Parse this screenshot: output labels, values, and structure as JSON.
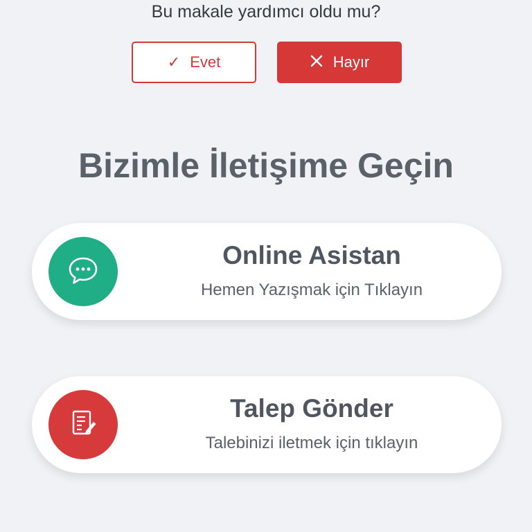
{
  "feedback": {
    "question": "Bu makale yardımcı oldu mu?",
    "yes_label": "Evet",
    "no_label": "Hayır",
    "yes_icon": "check-icon",
    "no_icon": "close-icon",
    "accent_color": "#d63838"
  },
  "contact": {
    "title": "Bizimle İletişime Geçin",
    "cards": [
      {
        "title": "Online Asistan",
        "subtitle": "Hemen Yazışmak için Tıklayın",
        "icon": "chat-bubble-icon",
        "color": "#1fae86"
      },
      {
        "title": "Talep Gönder",
        "subtitle": "Talebinizi iletmek için tıklayın",
        "icon": "document-edit-icon",
        "color": "#d73a3a"
      }
    ]
  }
}
